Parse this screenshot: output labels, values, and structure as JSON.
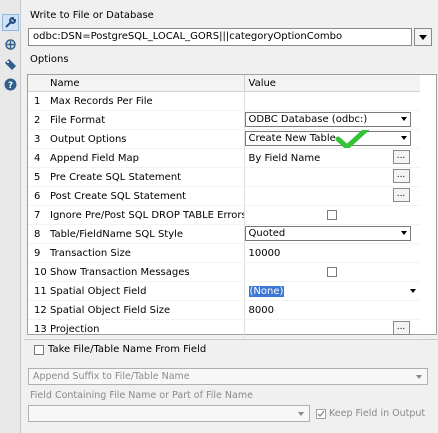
{
  "toolbar": {
    "tools": [
      "wrench-icon",
      "gear-icon",
      "tag-icon",
      "help-icon"
    ]
  },
  "header": {
    "label": "Write to File or Database"
  },
  "connection": {
    "value": "odbc:DSN=PostgreSQL_LOCAL_GORS|||categoryOptionCombo"
  },
  "options": {
    "label": "Options",
    "columns": [
      "Name",
      "Value"
    ],
    "rows": [
      {
        "num": "1",
        "name": "Max Records Per File",
        "value": "",
        "kind": "text"
      },
      {
        "num": "2",
        "name": "File Format",
        "value": "ODBC Database (odbc:)",
        "kind": "dropdown"
      },
      {
        "num": "3",
        "name": "Output Options",
        "value": "Create New Table",
        "kind": "dropdown"
      },
      {
        "num": "4",
        "name": "Append Field Map",
        "value": "By Field Name",
        "kind": "ellipsis"
      },
      {
        "num": "5",
        "name": "Pre Create SQL Statement",
        "value": "",
        "kind": "ellipsis"
      },
      {
        "num": "6",
        "name": "Post Create SQL Statement",
        "value": "",
        "kind": "ellipsis"
      },
      {
        "num": "7",
        "name": "Ignore Pre/Post SQL DROP TABLE Errors",
        "value": "",
        "kind": "checkbox"
      },
      {
        "num": "8",
        "name": "Table/FieldName SQL Style",
        "value": "Quoted",
        "kind": "dropdown"
      },
      {
        "num": "9",
        "name": "Transaction Size",
        "value": "10000",
        "kind": "text"
      },
      {
        "num": "10",
        "name": "Show Transaction Messages",
        "value": "",
        "kind": "checkbox"
      },
      {
        "num": "11",
        "name": "Spatial Object Field",
        "value": "(None)",
        "kind": "selected"
      },
      {
        "num": "12",
        "name": "Spatial Object Field Size",
        "value": "8000",
        "kind": "text"
      },
      {
        "num": "13",
        "name": "Projection",
        "value": "",
        "kind": "ellipsis"
      }
    ]
  },
  "take_from_field": {
    "label": "Take File/Table Name From Field"
  },
  "append_suffix": {
    "value": "Append Suffix to File/Table Name"
  },
  "field_containing": {
    "label": "Field Containing File Name or Part of File Name"
  },
  "keep_field": {
    "label": "Keep Field in Output"
  },
  "colors": {
    "checkmark": "#35c236",
    "selection": "#3b78d4"
  }
}
